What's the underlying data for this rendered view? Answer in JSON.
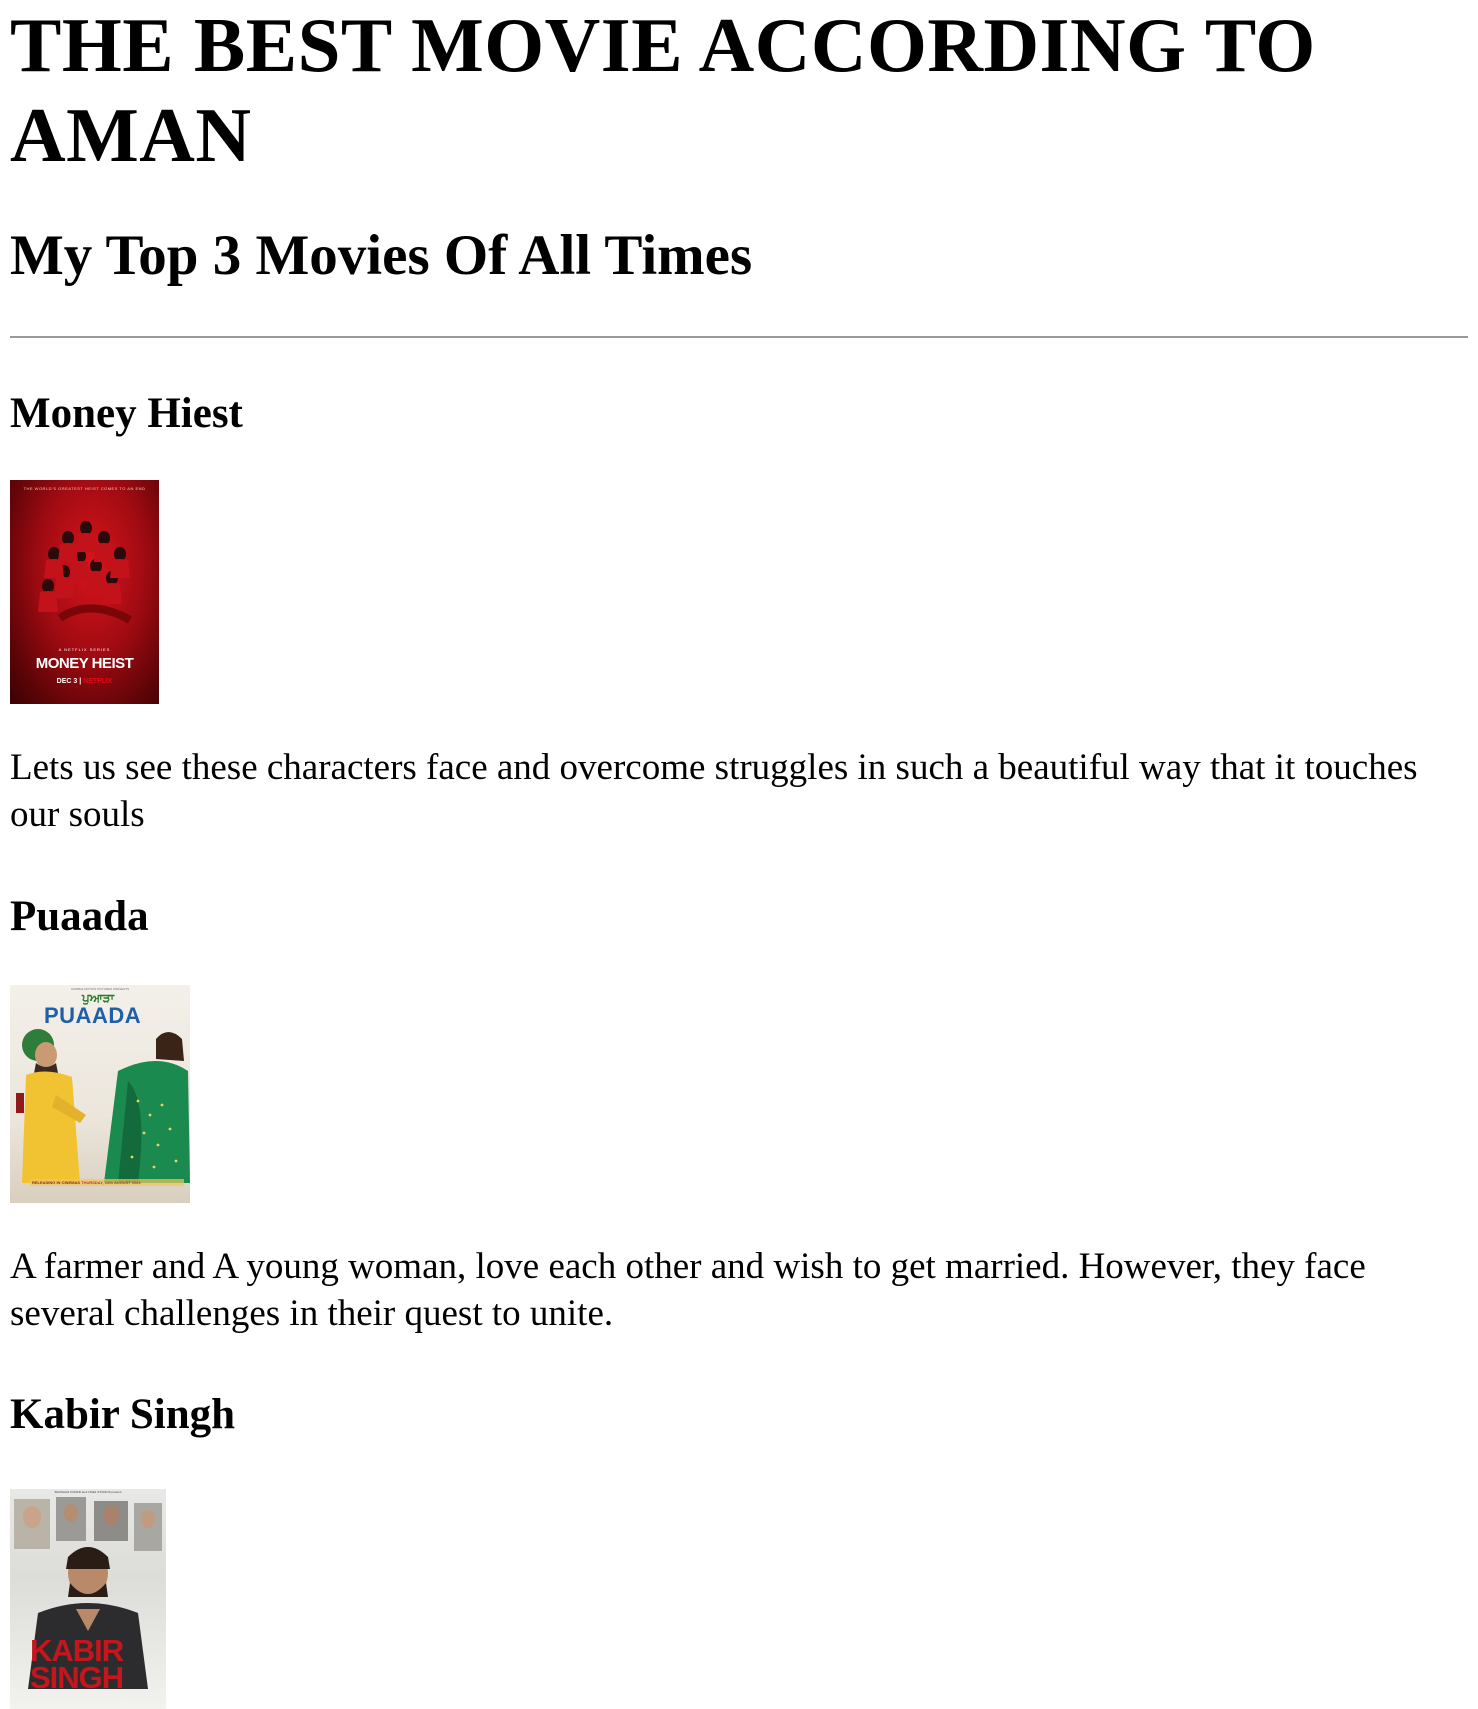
{
  "page": {
    "title": "THE BEST MOVIE ACCORDING TO AMAN",
    "subtitle": "My Top 3 Movies Of All Times"
  },
  "movies": [
    {
      "title": "Money Hiest",
      "description": "Lets us see these characters face and overcome struggles in such a beautiful way that it touches our souls",
      "poster": {
        "tagline": "THE WORLD'S GREATEST HEIST COMES TO AN END",
        "series_label": "A NETFLIX SERIES",
        "name": "MONEY HEIST",
        "date": "DEC 3",
        "network": "NETFLIX"
      }
    },
    {
      "title": "Puaada",
      "description": "A farmer and A young woman, love each other and wish to get married. However, they face several challenges in their quest to unite.",
      "poster": {
        "top_text": "HUMBLE MOTION PICTURES PRESENTS",
        "punjabi_title": "ਪੁਆੜਾ",
        "name": "PUAADA",
        "release_text": "RELEASING IN CINEMAS",
        "release_date": "THURSDAY, 12th AUGUST 2021"
      }
    },
    {
      "title": "Kabir Singh",
      "poster": {
        "top_text": "BHUSHAN KUMAR and CINE1 STUDIOS present",
        "name_line1": "KABIR",
        "name_line2": "SINGH"
      }
    }
  ],
  "colors": {
    "money_heist_red": "#d8141c",
    "netflix_red": "#e50914",
    "puaada_blue": "#1f5fa8",
    "kabir_red": "#c4161c",
    "rule_gray": "#9a9a9a"
  }
}
